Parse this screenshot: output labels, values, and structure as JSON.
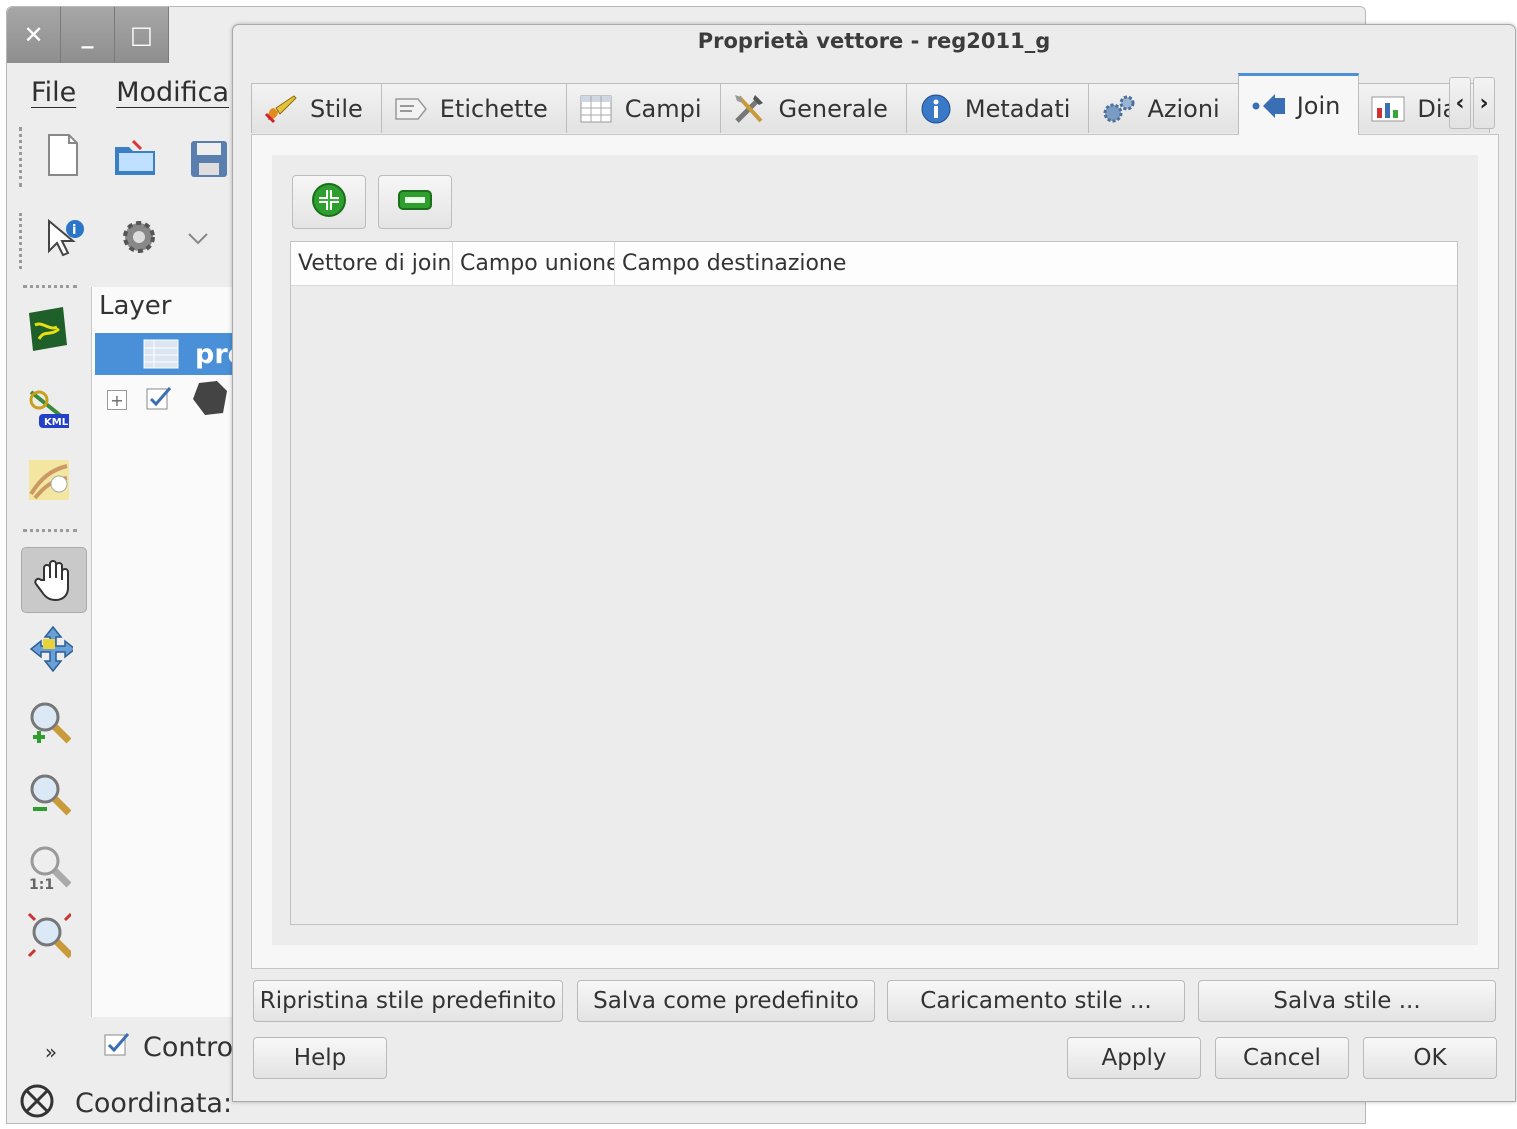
{
  "main_window": {
    "menu": [
      "File",
      "Modifica"
    ],
    "layers_title": "Layer",
    "selected_layer": "pro",
    "control_label": "Control",
    "status_coord_label": "Coordinata:"
  },
  "dialog": {
    "title": "Proprietà vettore - reg2011_g",
    "tabs": [
      {
        "label": "Stile",
        "icon": "brush-icon"
      },
      {
        "label": "Etichette",
        "icon": "label-icon"
      },
      {
        "label": "Campi",
        "icon": "table-icon"
      },
      {
        "label": "Generale",
        "icon": "tools-icon"
      },
      {
        "label": "Metadati",
        "icon": "info-icon"
      },
      {
        "label": "Azioni",
        "icon": "gears-icon"
      },
      {
        "label": "Join",
        "icon": "join-icon",
        "active": true
      },
      {
        "label": "Diagra",
        "icon": "diagram-icon"
      }
    ],
    "join_table": {
      "columns": [
        "Vettore di join",
        "Campo unione",
        "Campo destinazione"
      ]
    },
    "style_buttons": {
      "restore": "Ripristina stile predefinito",
      "save_default": "Salva come predefinito",
      "load": "Caricamento stile ...",
      "save": "Salva stile ..."
    },
    "buttons": {
      "help": "Help",
      "apply": "Apply",
      "cancel": "Cancel",
      "ok": "OK"
    }
  },
  "colors": {
    "accent": "#4a90d9",
    "add_green": "#2e9e2e"
  }
}
